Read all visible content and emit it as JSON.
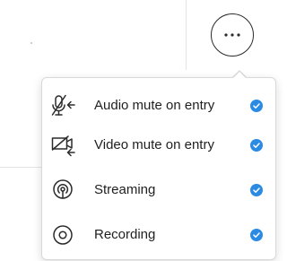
{
  "colors": {
    "check_blue": "#2b8be3",
    "icon_stroke": "#2b2b2b"
  },
  "more_button": {
    "icon": "more-horizontal-icon"
  },
  "menu": {
    "items": [
      {
        "label": "Audio mute on entry",
        "icon": "microphone-muted-arrow-icon",
        "checked": true
      },
      {
        "label": "Video mute on entry",
        "icon": "camera-muted-arrow-icon",
        "checked": true
      },
      {
        "label": "Streaming",
        "icon": "streaming-broadcast-icon",
        "checked": true
      },
      {
        "label": "Recording",
        "icon": "recording-icon",
        "checked": true
      }
    ]
  }
}
